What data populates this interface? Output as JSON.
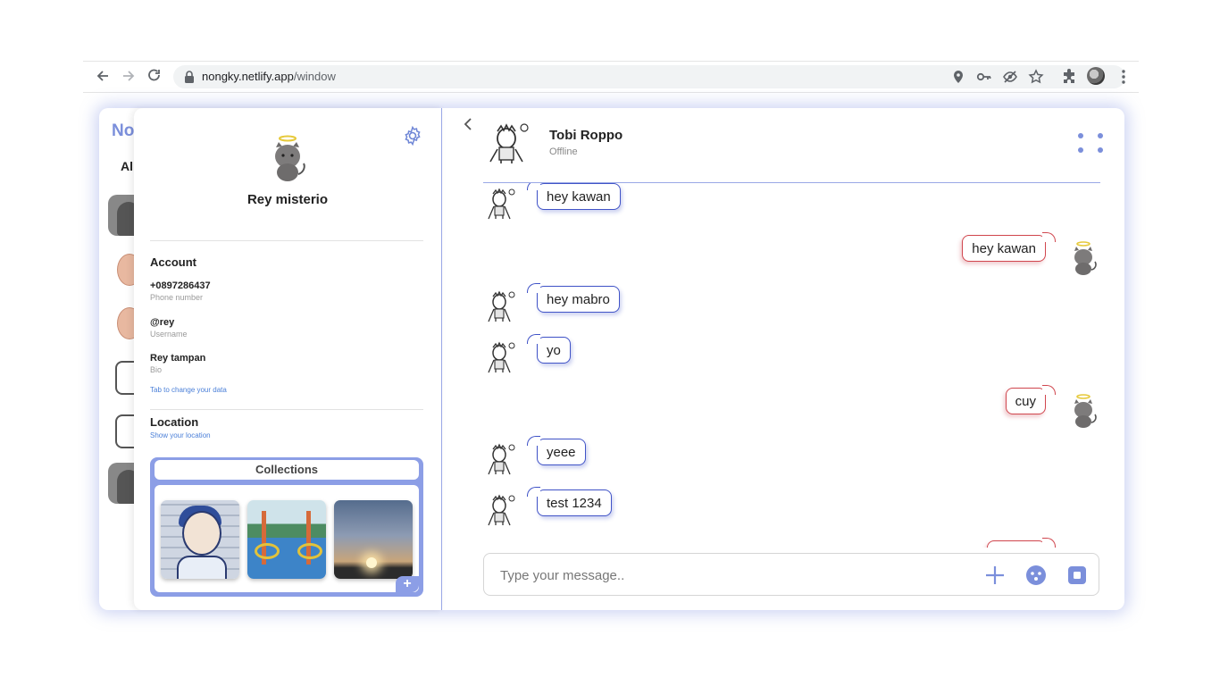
{
  "browser": {
    "url_host": "nongky.netlify.app",
    "url_path": "/window"
  },
  "contacts_peek": {
    "title": "No",
    "filter_label": "All"
  },
  "profile": {
    "name": "Rey misterio",
    "account_title": "Account",
    "phone": "+0897286437",
    "phone_label": "Phone number",
    "username": "@rey",
    "username_label": "Username",
    "bio": "Rey tampan",
    "bio_label": "Bio",
    "edit_hint": "Tab to change your data",
    "location_title": "Location",
    "location_link": "Show your location",
    "collections_title": "Collections",
    "collections_add": "+"
  },
  "chat": {
    "contact_name": "Tobi Roppo",
    "contact_status": "Offline",
    "messages": [
      {
        "from": "them",
        "text": "hey kawan"
      },
      {
        "from": "me",
        "text": "hey kawan"
      },
      {
        "from": "them",
        "text": "hey mabro"
      },
      {
        "from": "them",
        "text": "yo"
      },
      {
        "from": "me",
        "text": "cuy"
      },
      {
        "from": "them",
        "text": "yeee"
      },
      {
        "from": "them",
        "text": "test 1234"
      }
    ],
    "composer_placeholder": "Type your message.."
  },
  "colors": {
    "accent": "#7b8fdb",
    "incoming_border": "#4053c7",
    "outgoing_border": "#d0464e"
  }
}
